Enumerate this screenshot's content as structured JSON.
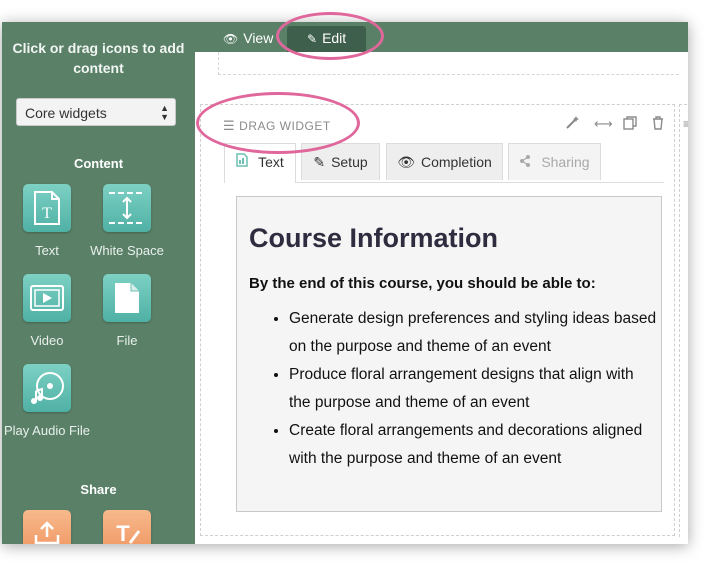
{
  "sidebar": {
    "title": "Click or drag icons to add content",
    "select_value": "Core widgets",
    "content_heading": "Content",
    "content_widgets": [
      {
        "label": "Text",
        "icon": "text-document-icon"
      },
      {
        "label": "White Space",
        "icon": "white-space-icon"
      },
      {
        "label": "Video",
        "icon": "video-icon"
      },
      {
        "label": "File",
        "icon": "file-icon"
      },
      {
        "label": "Play Audio File",
        "icon": "audio-disc-icon"
      }
    ],
    "share_heading": "Share",
    "share_widgets": [
      {
        "icon": "upload-icon"
      },
      {
        "icon": "text-edit-icon"
      }
    ]
  },
  "topbar": {
    "view_label": "View",
    "edit_label": "Edit"
  },
  "widget": {
    "drag_label": "DRAG WIDGET",
    "tabs": [
      {
        "label": "Text",
        "icon": "text-doc-icon",
        "state": "active"
      },
      {
        "label": "Setup",
        "icon": "pencil-icon",
        "state": "normal"
      },
      {
        "label": "Completion",
        "icon": "eye-icon",
        "state": "normal"
      },
      {
        "label": "Sharing",
        "icon": "share-icon",
        "state": "disabled"
      }
    ],
    "content": {
      "heading": "Course Information",
      "lead": "By the end of this course, you should be able to:",
      "bullets": [
        "Generate design preferences and styling ideas based on the purpose and theme of an event",
        "Produce floral arrangement designs that align with the purpose and theme of an event",
        "Create floral arrangements and decorations aligned with the purpose and theme of an event"
      ]
    }
  },
  "colors": {
    "sidebar_bg": "#5a8068",
    "tile_teal": "#5fbfb2",
    "tile_orange": "#f3a873",
    "annotation": "#e0679b",
    "heading": "#2e2c3e"
  }
}
